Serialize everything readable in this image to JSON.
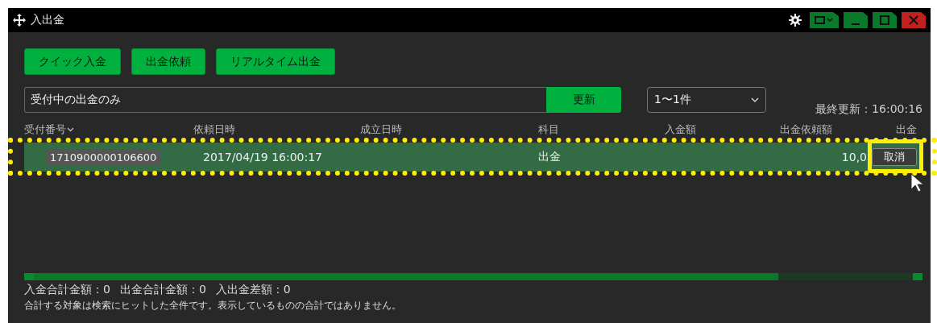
{
  "window": {
    "title": "入出金"
  },
  "action_buttons": [
    "クイック入金",
    "出金依頼",
    "リアルタイム出金"
  ],
  "filter": {
    "value": "受付中の出金のみ",
    "button": "更新"
  },
  "range_select": {
    "value": "1〜1件"
  },
  "last_updated": "最終更新：16:00:16",
  "table": {
    "columns": [
      {
        "label": "受付番号",
        "sorted": true
      },
      {
        "label": "依頼日時",
        "sorted": false
      },
      {
        "label": "成立日時",
        "sorted": false
      },
      {
        "label": "科目",
        "sorted": false
      },
      {
        "label": "入金額",
        "sorted": false
      },
      {
        "label": "出金依頼額",
        "sorted": false
      },
      {
        "label": "出金",
        "sorted": false
      }
    ],
    "rows": [
      {
        "receipt_no": "1710900000106600",
        "requested_at": "2017/04/19 16:00:17",
        "settled_at": "",
        "type": "出金",
        "deposit": "",
        "withdrawal_request": "10,0",
        "action": "取消",
        "highlighted": true
      }
    ]
  },
  "totals": [
    "入金合計金額：0",
    "出金合計金額：0",
    "入出金差額：0"
  ],
  "note": "合計する対象は検索にヒットした全件です。表示しているものの合計ではありません。"
}
